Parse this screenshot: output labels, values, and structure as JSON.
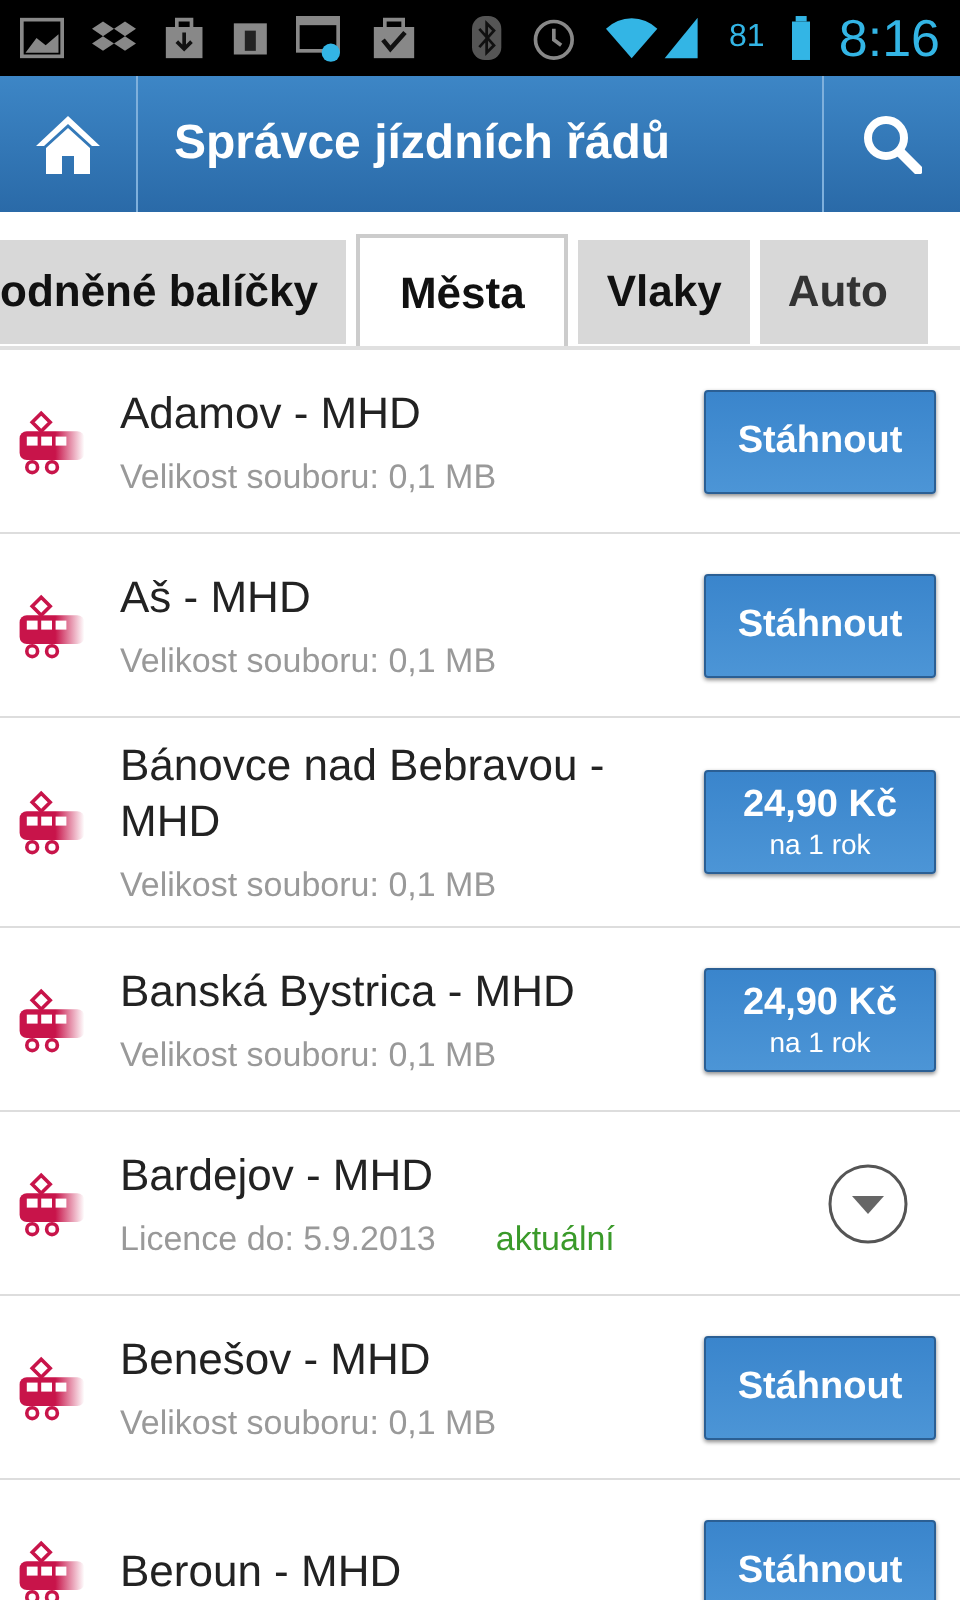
{
  "status_bar": {
    "battery": "81",
    "time": "8:16"
  },
  "app_bar": {
    "title": "Správce jízdních řádů"
  },
  "tabs": [
    {
      "label": "odněné balíčky",
      "selected": false
    },
    {
      "label": "Města",
      "selected": true
    },
    {
      "label": "Vlaky",
      "selected": false
    },
    {
      "label": "Auto",
      "selected": false
    }
  ],
  "rows": [
    {
      "kind": "download",
      "title": "Adamov - MHD",
      "subtitle": "Velikost souboru: 0,1 MB",
      "button": "Stáhnout"
    },
    {
      "kind": "download",
      "title": "Aš - MHD",
      "subtitle": "Velikost souboru: 0,1 MB",
      "button": "Stáhnout"
    },
    {
      "kind": "price",
      "title": "Bánovce nad Bebravou - MHD",
      "subtitle": "Velikost souboru: 0,1 MB",
      "button": "24,90 Kč",
      "button_note": "na 1 rok"
    },
    {
      "kind": "price",
      "title": "Banská Bystrica - MHD",
      "subtitle": "Velikost souboru: 0,1 MB",
      "button": "24,90 Kč",
      "button_note": "na 1 rok"
    },
    {
      "kind": "owned",
      "title": "Bardejov - MHD",
      "subtitle": "Licence do: 5.9.2013",
      "status": "aktuální"
    },
    {
      "kind": "download",
      "title": "Benešov - MHD",
      "subtitle": "Velikost souboru: 0,1 MB",
      "button": "Stáhnout"
    },
    {
      "kind": "download",
      "title": "Beroun - MHD",
      "button": "Stáhnout"
    }
  ]
}
